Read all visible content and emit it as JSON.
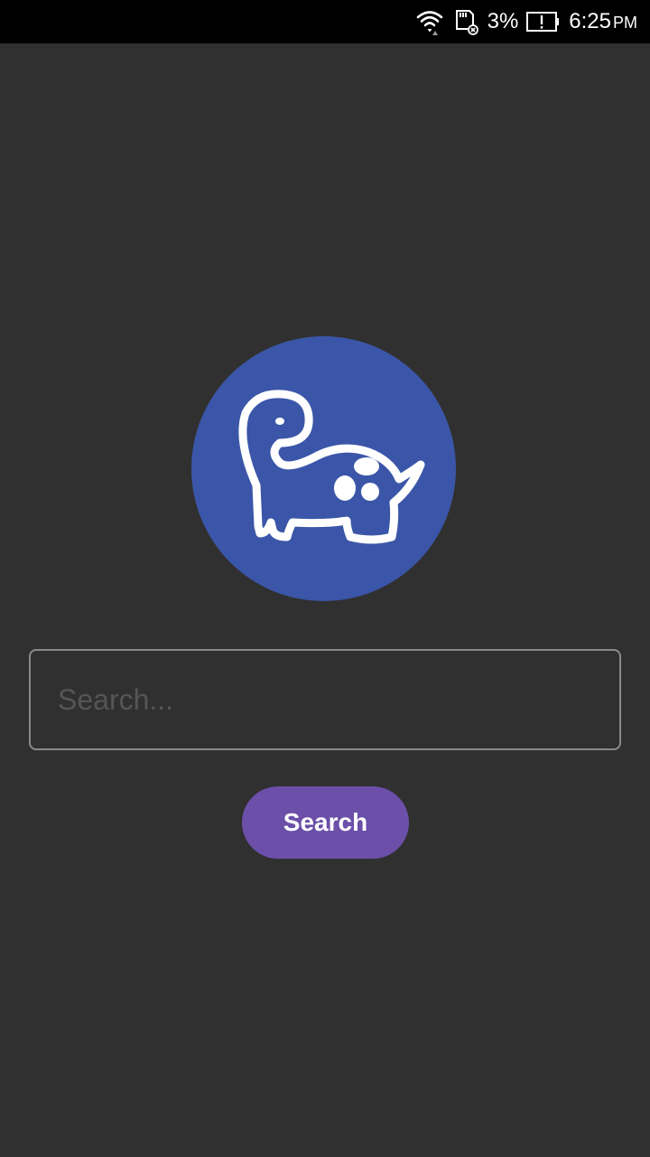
{
  "status_bar": {
    "icons": [
      "wifi-icon",
      "sd-card-icon",
      "battery-alert-icon"
    ],
    "battery_percent": "3%",
    "time": "6:25",
    "ampm": "PM"
  },
  "logo": {
    "icon": "dinosaur-icon",
    "background_color": "#3b56a8"
  },
  "search": {
    "placeholder": "Search...",
    "value": "",
    "button_label": "Search",
    "button_color": "#6b4fa8"
  }
}
